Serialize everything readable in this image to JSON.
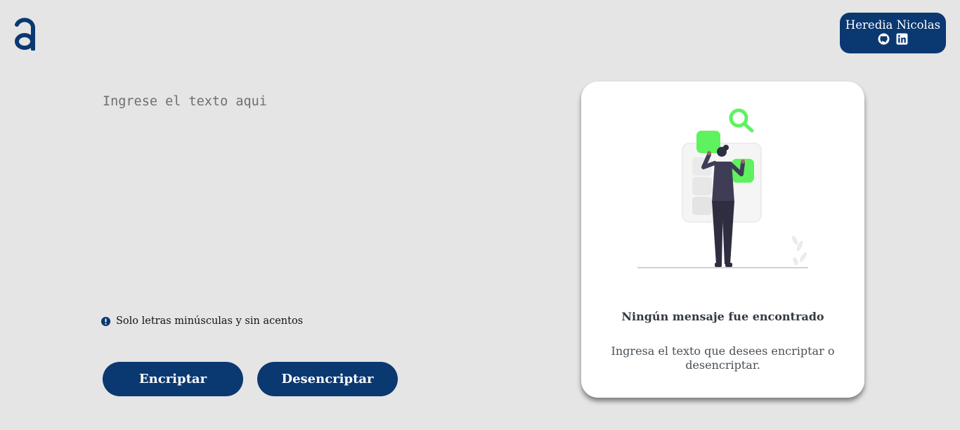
{
  "brand": {
    "logo_icon": "alura-a-logo-icon",
    "color": "#0a3871"
  },
  "author": {
    "name": "Heredia Nicolas",
    "links": [
      {
        "icon": "github-icon"
      },
      {
        "icon": "linkedin-icon"
      }
    ]
  },
  "input": {
    "placeholder": "Ingrese el texto aqui",
    "value": ""
  },
  "hint": {
    "icon": "exclamation-circle-icon",
    "text": "Solo letras minúsculas y sin acentos"
  },
  "buttons": {
    "encrypt_label": "Encriptar",
    "decrypt_label": "Desencriptar"
  },
  "output": {
    "illustration": "person-searching-illustration",
    "title": "Ningún mensaje fue encontrado",
    "text": "Ingresa el texto que desees encriptar o desencriptar."
  },
  "colors": {
    "background": "#e5e5e5",
    "primary": "#0a3871",
    "accent_green": "#5ff25f",
    "card": "#ffffff"
  }
}
